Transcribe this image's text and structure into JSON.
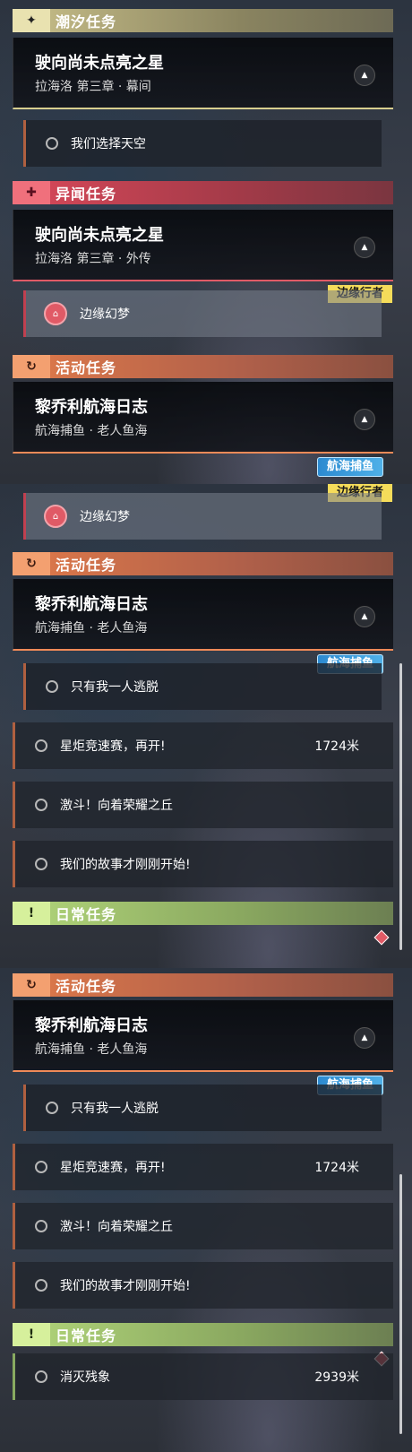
{
  "panels": {
    "p1": {
      "chaoxi": {
        "header": "潮汐任务",
        "icon": "✦",
        "title": "驶向尚未点亮之星",
        "subtitle": "拉海洛 第三章 · 幕间",
        "sub1": "我们选择天空"
      },
      "yiwen": {
        "header": "异闻任务",
        "icon": "✚",
        "title": "驶向尚未点亮之星",
        "subtitle": "拉海洛 第三章 · 外传",
        "tag": "边缘行者",
        "sub1": "边缘幻梦"
      },
      "huodong": {
        "header": "活动任务",
        "icon": "↻",
        "title": "黎乔利航海日志",
        "subtitle": "航海捕鱼 · 老人鱼海",
        "tag": "航海捕鱼"
      }
    },
    "p2": {
      "tag_yellow": "边缘行者",
      "sub0": "边缘幻梦",
      "huodong": {
        "header": "活动任务",
        "icon": "↻",
        "title": "黎乔利航海日志",
        "subtitle": "航海捕鱼 · 老人鱼海",
        "tag": "航海捕鱼"
      },
      "items": [
        {
          "label": "只有我一人逃脱",
          "dist": ""
        },
        {
          "label": "星炬竞速赛，再开!",
          "dist": "1724米"
        },
        {
          "label": "激斗！向着荣耀之丘",
          "dist": ""
        },
        {
          "label": "我们的故事才刚刚开始!",
          "dist": ""
        }
      ],
      "richang": {
        "header": "日常任务",
        "icon": "!"
      }
    },
    "p3": {
      "huodong": {
        "header": "活动任务",
        "icon": "↻",
        "title": "黎乔利航海日志",
        "subtitle": "航海捕鱼 · 老人鱼海",
        "tag": "航海捕鱼"
      },
      "items": [
        {
          "label": "只有我一人逃脱",
          "dist": ""
        },
        {
          "label": "星炬竞速赛，再开!",
          "dist": "1724米"
        },
        {
          "label": "激斗！向着荣耀之丘",
          "dist": ""
        },
        {
          "label": "我们的故事才刚刚开始!",
          "dist": ""
        }
      ],
      "richang": {
        "header": "日常任务",
        "icon": "!",
        "sub": "消灭残象",
        "dist": "2939米"
      }
    }
  },
  "colors": {
    "tidal": "#d8cf8f",
    "anomaly": "#e05a66",
    "event": "#f08a58",
    "daily": "#b2d67a"
  }
}
